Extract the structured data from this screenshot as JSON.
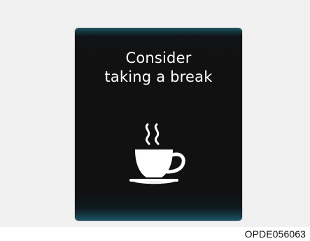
{
  "display": {
    "line1": "Consider",
    "line2": "taking a break",
    "icon": "coffee-cup-icon"
  },
  "figure_code": "OPDE056063",
  "colors": {
    "screen_background": "#111111",
    "screen_edge_glow": "#1d5665",
    "text": "#ffffff"
  }
}
